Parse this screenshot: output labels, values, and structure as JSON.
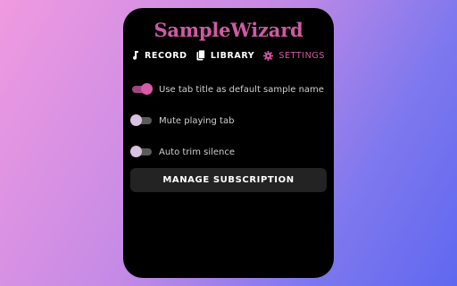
{
  "app": {
    "title": "SampleWizard"
  },
  "tabs": [
    {
      "label": "RECORD",
      "icon": "music-note-icon",
      "active": false
    },
    {
      "label": "LIBRARY",
      "icon": "clipboard-icon",
      "active": false
    },
    {
      "label": "SETTINGS",
      "icon": "gear-icon",
      "active": true
    }
  ],
  "settings": {
    "options": [
      {
        "label": "Use tab title as default sample name",
        "enabled": true
      },
      {
        "label": "Mute playing tab",
        "enabled": false
      },
      {
        "label": "Auto trim silence",
        "enabled": false
      }
    ],
    "manage_label": "MANAGE SUBSCRIPTION"
  },
  "colors": {
    "accent": "#d05aa4",
    "panel": "#000000",
    "button": "#232323"
  }
}
